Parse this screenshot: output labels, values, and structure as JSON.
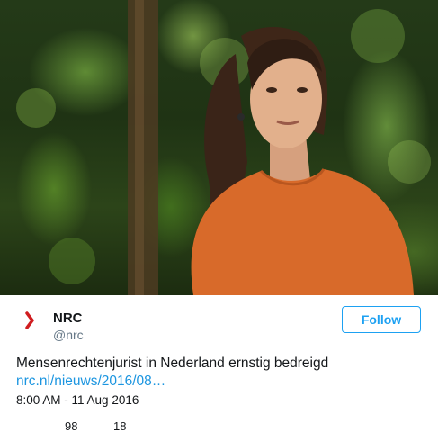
{
  "tweet": {
    "author": {
      "name": "NRC",
      "handle": "@nrc",
      "logo_icon": "nrc-chevron-logo-icon",
      "logo_color": "#d01d20"
    },
    "follow_label": "Follow",
    "text": "Mensenrechtenjurist in Nederland ernstig bedreigd",
    "link_text": "nrc.nl/nieuws/2016/08…",
    "timestamp": "8:00 AM - 11 Aug 2016",
    "actions": {
      "likes": {
        "icon": "heart-icon",
        "count": "98"
      },
      "retweets": {
        "icon": "retweet-icon",
        "count": "18"
      }
    }
  },
  "colors": {
    "accent": "#1da1f2",
    "link": "#1b95e0",
    "text": "#14171a",
    "muted": "#657786"
  }
}
